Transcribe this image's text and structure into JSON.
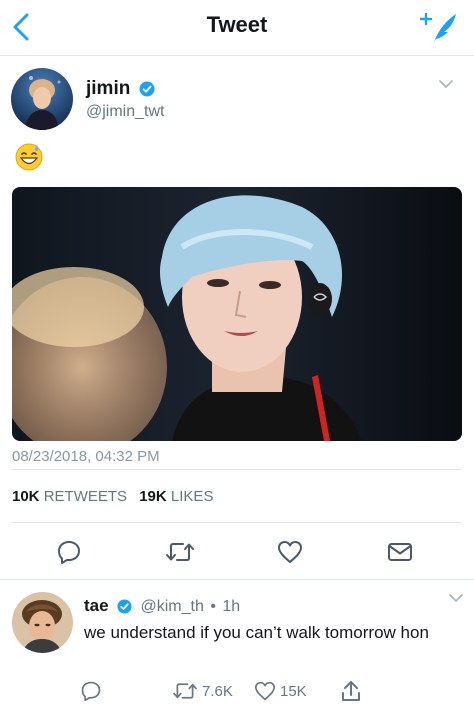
{
  "navbar": {
    "title": "Tweet",
    "back_icon": "chevron-left-icon",
    "compose_icon": "compose-quill-icon",
    "accent_color": "#1da1f2"
  },
  "main_tweet": {
    "author_name": "jimin",
    "author_handle": "@jimin_twt",
    "verified": true,
    "text_emoji": "grinning-face-with-sweat-emoji",
    "timestamp": "08/23/2018, 04:32 PM",
    "retweets_count": "10K",
    "retweets_label": "RETWEETS",
    "likes_count": "19K",
    "likes_label": "LIKES",
    "actions": [
      "reply-icon",
      "retweet-icon",
      "like-icon",
      "direct-message-icon"
    ]
  },
  "reply_tweet": {
    "author_name": "tae",
    "author_handle": "@kim_th",
    "separator": "•",
    "time": "1h",
    "verified": true,
    "text": "we understand if you can’t walk tomorrow hon",
    "retweet_count": "7.6K",
    "like_count": "15K",
    "actions": [
      "reply-icon",
      "retweet-icon",
      "like-icon",
      "share-icon"
    ]
  }
}
